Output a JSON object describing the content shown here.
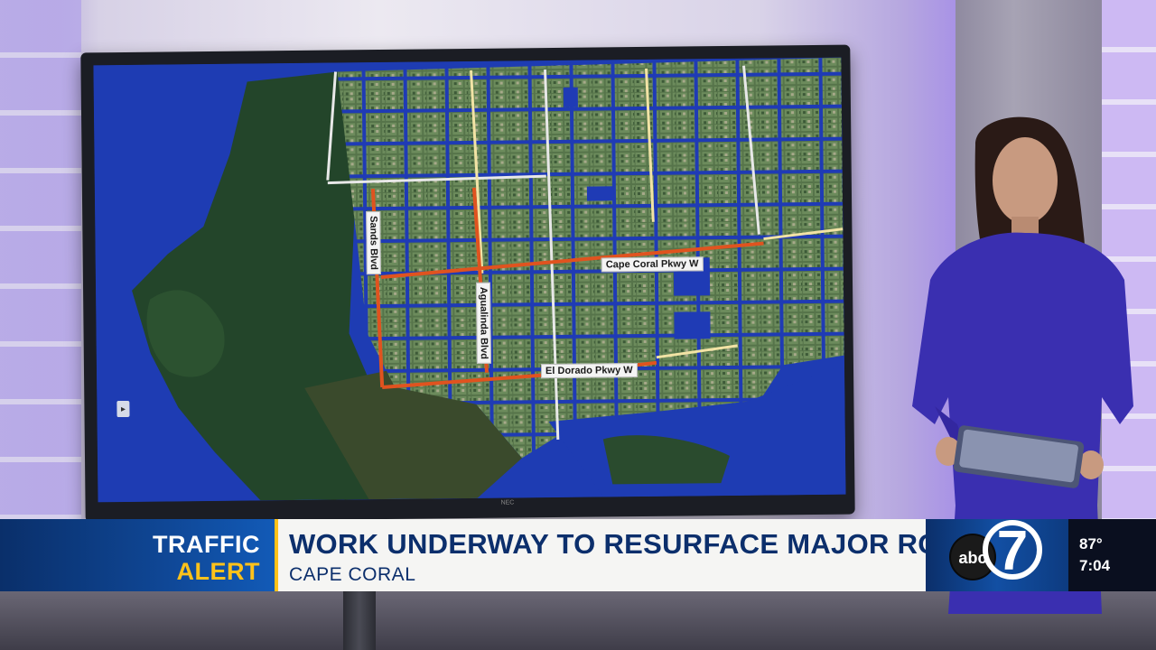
{
  "map": {
    "road_labels": {
      "sands": "Sands Blvd",
      "agualinda": "Agualinda Blvd",
      "cape_coral": "Cape Coral Pkwy W",
      "el_dorado": "El Dorado Pkwy W"
    },
    "highlight_color": "#e0531f",
    "water_color": "#1e3cb3",
    "land_color": "#264a2c"
  },
  "monitor": {
    "brand": "NEC"
  },
  "lower_third": {
    "category_line1": "TRAFFIC",
    "category_line2": "ALERT",
    "headline": "WORK UNDERWAY TO RESURFACE MAJOR ROADS",
    "location": "CAPE CORAL",
    "logo_text": "abc",
    "logo_number": "7",
    "temperature": "87°",
    "time": "7:04",
    "colors": {
      "navy": "#0c2f6c",
      "accent_yellow": "#ffc21a"
    }
  }
}
